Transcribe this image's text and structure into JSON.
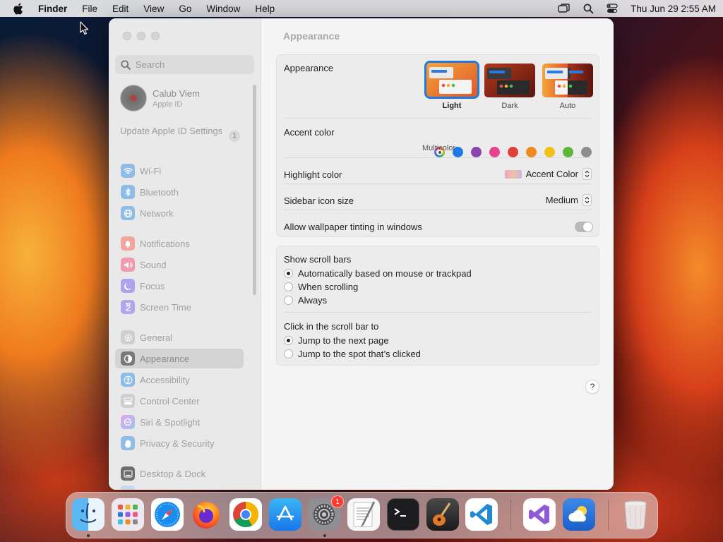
{
  "menubar": {
    "app": "Finder",
    "items": [
      "File",
      "Edit",
      "View",
      "Go",
      "Window",
      "Help"
    ],
    "datetime": "Thu Jun 29  2:55 AM"
  },
  "sidebar": {
    "search_placeholder": "Search",
    "profile": {
      "name": "Calub Viem",
      "subtitle": "Apple ID"
    },
    "update": {
      "label": "Update Apple ID Settings",
      "badge": "1"
    },
    "items": [
      {
        "label": "Wi-Fi",
        "icon": "wifi-icon",
        "color": "#1e8cf0"
      },
      {
        "label": "Bluetooth",
        "icon": "bluetooth-icon",
        "color": "#1e8cf0"
      },
      {
        "label": "Network",
        "icon": "globe-icon",
        "color": "#1e8cf0"
      },
      {
        "label": "Notifications",
        "icon": "bell-icon",
        "color": "#f05a4a"
      },
      {
        "label": "Sound",
        "icon": "speaker-icon",
        "color": "#f0456a"
      },
      {
        "label": "Focus",
        "icon": "moon-icon",
        "color": "#6a5ae0"
      },
      {
        "label": "Screen Time",
        "icon": "hourglass-icon",
        "color": "#7a5ae0"
      },
      {
        "label": "General",
        "icon": "gear-icon",
        "color": "#9a9a9a"
      },
      {
        "label": "Appearance",
        "icon": "appearance-icon",
        "color": "#333333"
      },
      {
        "label": "Accessibility",
        "icon": "accessibility-icon",
        "color": "#1e8cf0"
      },
      {
        "label": "Control Center",
        "icon": "control-center-icon",
        "color": "#9a9a9a"
      },
      {
        "label": "Siri & Spotlight",
        "icon": "siri-icon",
        "color": "#c050d0"
      },
      {
        "label": "Privacy & Security",
        "icon": "hand-icon",
        "color": "#1e8cf0"
      },
      {
        "label": "Desktop & Dock",
        "icon": "dock-icon",
        "color": "#333333"
      }
    ]
  },
  "main": {
    "title": "Appearance",
    "appearance": {
      "label": "Appearance",
      "options": [
        {
          "label": "Light",
          "selected": true
        },
        {
          "label": "Dark",
          "selected": false
        },
        {
          "label": "Auto",
          "selected": false
        }
      ]
    },
    "accent": {
      "label": "Accent color",
      "selected_label": "Multicolor",
      "colors": [
        "multicolor",
        "#1e7be6",
        "#8e44ad",
        "#e8428e",
        "#e0403a",
        "#ef8a1f",
        "#f3c018",
        "#5bb83a",
        "#8e8e8e"
      ]
    },
    "highlight": {
      "label": "Highlight color",
      "value": "Accent Color"
    },
    "sidebar_icon_size": {
      "label": "Sidebar icon size",
      "value": "Medium"
    },
    "wallpaper_tinting": {
      "label": "Allow wallpaper tinting in windows",
      "enabled": false
    },
    "scroll_bars": {
      "label": "Show scroll bars",
      "options": [
        {
          "label": "Automatically based on mouse or trackpad",
          "selected": true
        },
        {
          "label": "When scrolling",
          "selected": false
        },
        {
          "label": "Always",
          "selected": false
        }
      ]
    },
    "click_scroll": {
      "label": "Click in the scroll bar to",
      "options": [
        {
          "label": "Jump to the next page",
          "selected": true
        },
        {
          "label": "Jump to the spot that’s clicked",
          "selected": false
        }
      ]
    },
    "help": "?"
  },
  "dock": {
    "apps": [
      {
        "name": "Finder",
        "icon": "finder-icon",
        "running": true
      },
      {
        "name": "Launchpad",
        "icon": "launchpad-icon",
        "running": false
      },
      {
        "name": "Safari",
        "icon": "safari-icon",
        "running": false
      },
      {
        "name": "Firefox",
        "icon": "firefox-icon",
        "running": false
      },
      {
        "name": "Chrome",
        "icon": "chrome-icon",
        "running": false
      },
      {
        "name": "App Store",
        "icon": "app-store-icon",
        "running": false
      },
      {
        "name": "System Settings",
        "icon": "system-settings-icon",
        "running": true,
        "badge": "1"
      },
      {
        "name": "TextEdit",
        "icon": "textedit-icon",
        "running": false
      },
      {
        "name": "Terminal",
        "icon": "terminal-icon",
        "running": false
      },
      {
        "name": "GarageBand",
        "icon": "garageband-icon",
        "running": false
      },
      {
        "name": "Visual Studio Code",
        "icon": "vscode-icon",
        "running": false
      },
      {
        "name": "Visual Studio",
        "icon": "visual-studio-icon",
        "running": false
      },
      {
        "name": "Weather",
        "icon": "weather-icon",
        "running": false
      },
      {
        "name": "Trash",
        "icon": "trash-icon",
        "running": false
      }
    ]
  }
}
